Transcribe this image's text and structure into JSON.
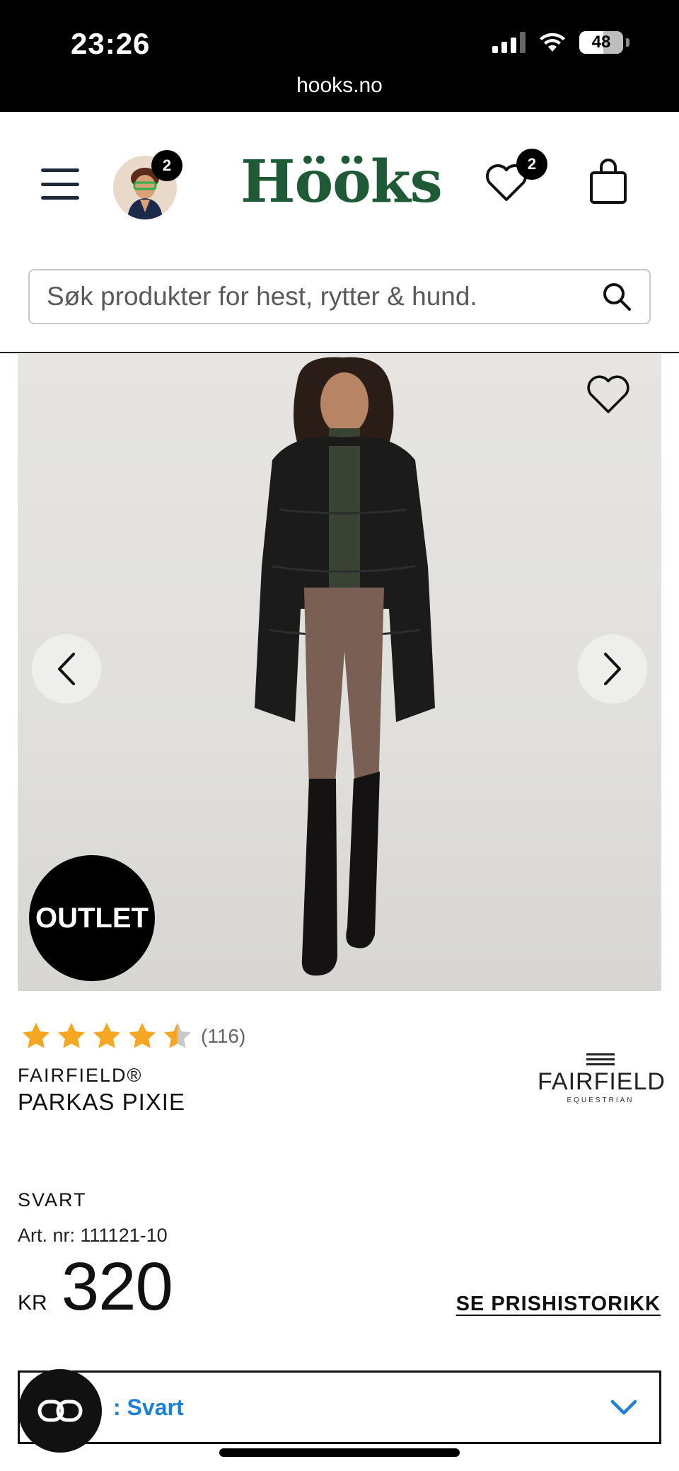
{
  "status_bar": {
    "time": "23:26",
    "battery": "48",
    "url": "hooks.no"
  },
  "header": {
    "logo": "Hööks",
    "avatar_badge": "2",
    "wishlist_badge": "2",
    "search_placeholder": "Søk produkter for hest, rytter & hund."
  },
  "gallery": {
    "outlet_label": "OUTLET"
  },
  "product": {
    "rating_value": 4.5,
    "rating_max": 5,
    "rating_count": "(116)",
    "brand": "FAIRFIELD®",
    "name": "PARKAS PIXIE",
    "brand_logo_main": "FAIRFIELD",
    "brand_logo_sub": "EQUESTRIAN",
    "color": "SVART",
    "article_number": "Art. nr: 111121-10",
    "price_currency": "KR",
    "price_value": "320",
    "price_history_link": "SE PRISHISTORIKK",
    "variant_selected": ": Svart"
  },
  "colors": {
    "logo_green": "#1f5a36",
    "variant_blue": "#1f7fd6",
    "star_gold": "#f5a623"
  }
}
